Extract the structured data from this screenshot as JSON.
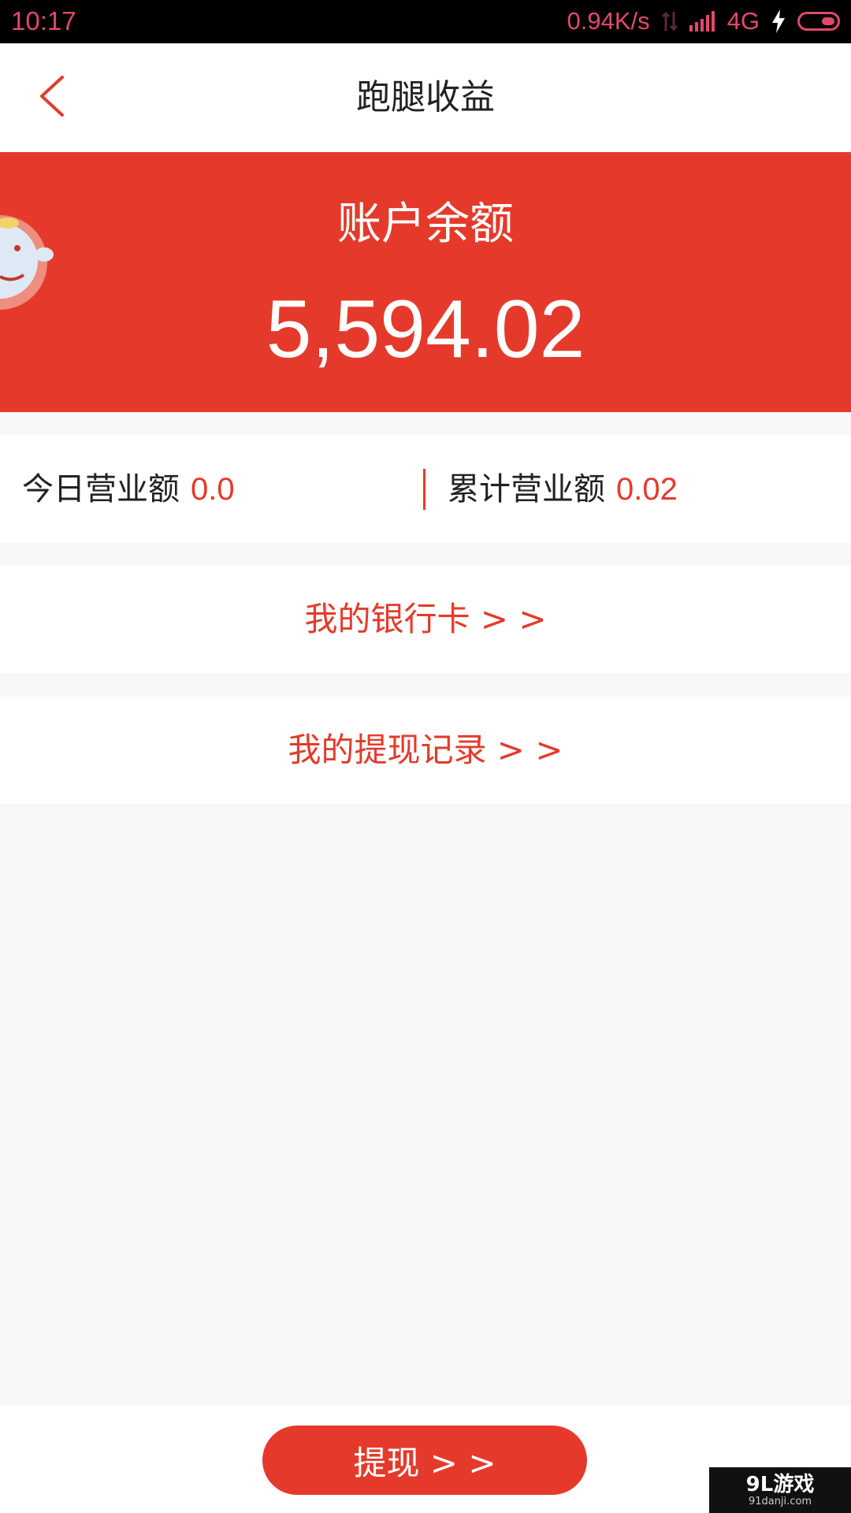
{
  "status_bar": {
    "time": "10:17",
    "speed": "0.94K/s",
    "network": "4G",
    "color": "#e2486b"
  },
  "header": {
    "title": "跑腿收益",
    "back_icon": "chevron-left-icon"
  },
  "balance": {
    "label": "账户余额",
    "amount": "5,594.02",
    "background": "#e53a2b"
  },
  "stats": {
    "today_label": "今日营业额",
    "today_value": "0.0",
    "total_label": "累计营业额",
    "total_value": "0.02"
  },
  "links": {
    "bank_card": "我的银行卡 > >",
    "withdraw_records": "我的提现记录 > >"
  },
  "footer": {
    "withdraw_button": "提现 > >"
  },
  "watermark": {
    "main": "9L游戏",
    "sub": "91danji.com"
  },
  "colors": {
    "accent": "#e53a2b",
    "text": "#222222",
    "page_bg": "#f7f7f7"
  }
}
